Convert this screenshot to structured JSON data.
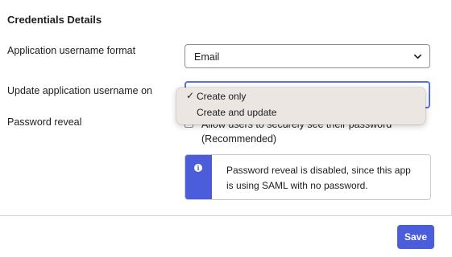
{
  "section": {
    "title": "Credentials Details"
  },
  "username_format": {
    "label": "Application username format",
    "selected": "Email"
  },
  "update_username": {
    "label": "Update application username on",
    "options": [
      {
        "label": "Create only",
        "selected": true
      },
      {
        "label": "Create and update",
        "selected": false
      }
    ]
  },
  "password_reveal": {
    "label": "Password reveal",
    "checkbox_line1": "Allow users to securely see their password",
    "checkbox_line2": "(Recommended)",
    "checked": false,
    "notice_icon": "info-icon",
    "notice": "Password reveal is disabled, since this app is using SAML with no password."
  },
  "footer": {
    "save_label": "Save"
  },
  "colors": {
    "accent": "#4b5ddb",
    "focus": "#5a6ee6",
    "menu_bg": "#ebe6e1"
  }
}
